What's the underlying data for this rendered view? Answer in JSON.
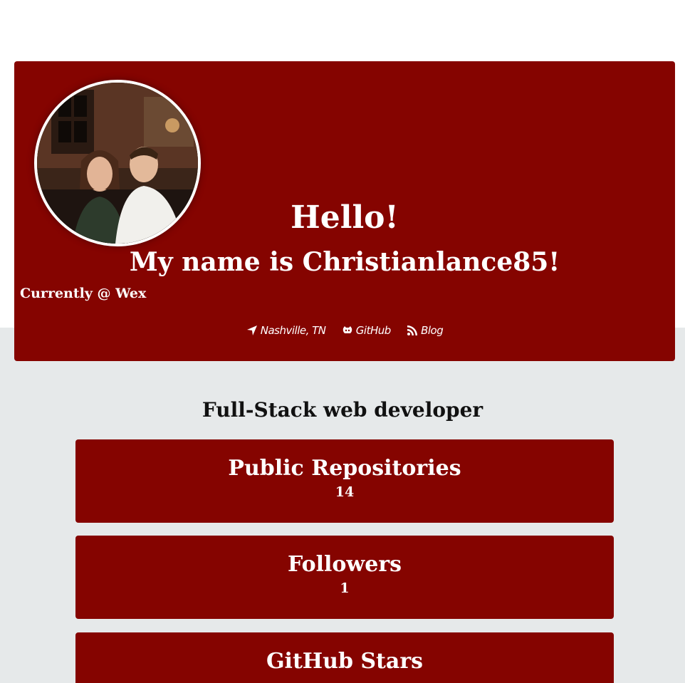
{
  "hero": {
    "greeting": "Hello!",
    "name_line": "My name is Christianlance85!",
    "currently": "Currently @ Wex",
    "avatar_alt": "profile photo",
    "links": [
      {
        "icon": "location-arrow-icon",
        "label": "Nashville, TN"
      },
      {
        "icon": "github-icon",
        "label": "GitHub"
      },
      {
        "icon": "rss-icon",
        "label": "Blog"
      }
    ]
  },
  "tagline": "Full-Stack web developer",
  "stats": [
    {
      "title": "Public Repositories",
      "value": "14"
    },
    {
      "title": "Followers",
      "value": "1"
    },
    {
      "title": "GitHub Stars",
      "value": ""
    }
  ],
  "colors": {
    "accent": "#850400",
    "page_background": "#e6e9ea",
    "header_background": "#ffffff",
    "text_light": "#ffffff",
    "text_dark": "#111111"
  }
}
